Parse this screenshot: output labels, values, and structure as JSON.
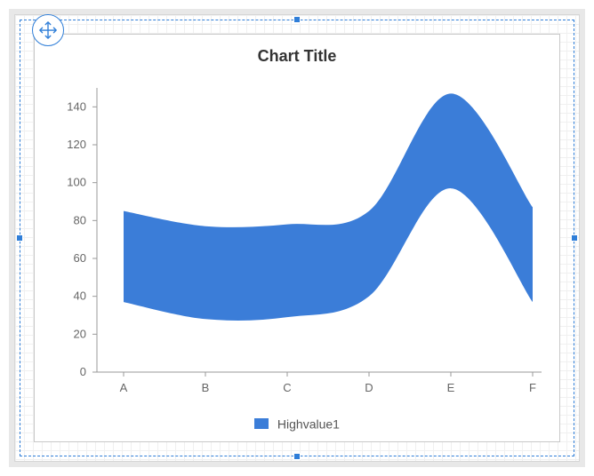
{
  "chart_data": {
    "type": "area",
    "title": "Chart Title",
    "categories": [
      "A",
      "B",
      "C",
      "D",
      "E",
      "F"
    ],
    "series": [
      {
        "name": "Highvalue1",
        "high": [
          85,
          77,
          78,
          85,
          147,
          87
        ],
        "low": [
          37,
          28,
          29,
          40,
          97,
          37
        ]
      }
    ],
    "ylabel": "",
    "xlabel": "",
    "ylim": [
      0,
      150
    ],
    "yticks": [
      0,
      20,
      40,
      60,
      80,
      100,
      120,
      140
    ],
    "legend_position": "bottom",
    "accent_color": "#3b7dd8"
  },
  "editor": {
    "selected": true
  }
}
